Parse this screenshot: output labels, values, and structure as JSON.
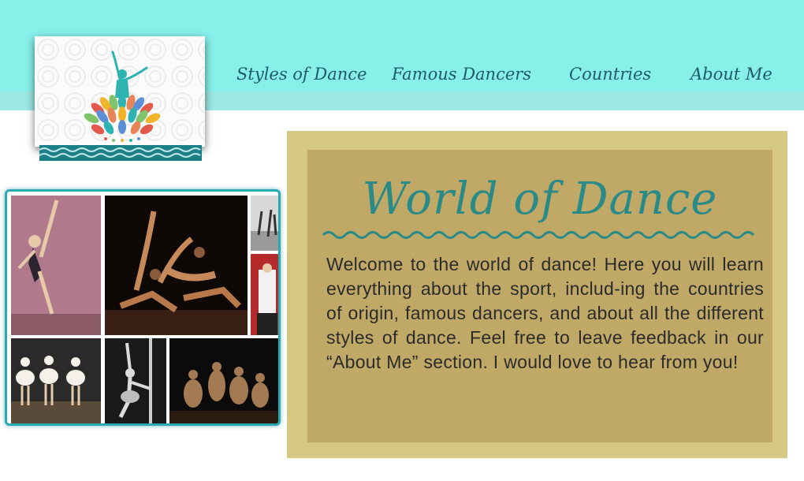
{
  "nav": {
    "items": [
      {
        "label": "Styles of Dance"
      },
      {
        "label": "Famous Dancers"
      },
      {
        "label": "Countries"
      },
      {
        "label": "About Me"
      }
    ]
  },
  "logo": {
    "icon": "dancer-logo-icon"
  },
  "colors": {
    "header": "#86f0e9",
    "accent": "#2a8a88",
    "panel_outer": "#d4c884",
    "panel_inner": "#c0a866"
  },
  "main": {
    "title": "World of Dance",
    "intro": "Welcome to the world of dance! Here you will learn everything about the sport, includ-ing the countries of origin, famous dancers, and about all the different styles of dance. Feel free to leave feedback in our “About Me” section. I would love to hear from you!"
  }
}
